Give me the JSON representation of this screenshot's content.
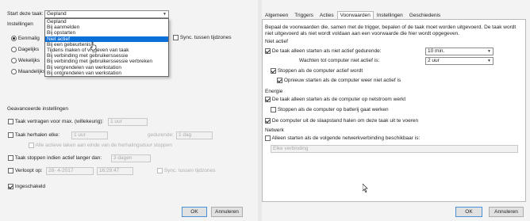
{
  "left": {
    "start_task_label": "Start deze taak:",
    "start_task_value": "Gepland",
    "dropdown_options": [
      "Gepland",
      "Bij aanmelden",
      "Bij opstarten",
      "Niet actief",
      "Bij een gebeurtenis",
      "Tijdens maken of vrijgeven van taak",
      "Bij verbinding met gebruikerssessie",
      "Bij verbinding met gebruikerssessie verbreken",
      "Bij vergrendelen van werkstation",
      "Bij ontgrendelen van werkstation"
    ],
    "selected_option_index": 3,
    "settings_label": "Instellingen",
    "radio_once": "Eenmalig",
    "radio_daily": "Dagelijks",
    "radio_weekly": "Wekelijks",
    "radio_monthly": "Maandelijks",
    "sync_timezones": "Sync. tussen tijdzones",
    "advanced_label": "Geavanceerde instellingen",
    "delay_task": "Taak vertragen voor max. (willekeurig):",
    "delay_value": "1 uur",
    "repeat_task": "Taak herhalen elke:",
    "repeat_value": "1 uur",
    "duration_label": "gedurende:",
    "duration_value": "1 dag",
    "stop_running": "Alle actieve taken aan einde van de herhalingsduur stoppen",
    "stop_longer": "Taak stoppen indien actief langer dan:",
    "stop_longer_value": "3 dagen",
    "expires": "Verloopt op:",
    "expires_date": "28- 4-2017",
    "expires_time": "16:29:47",
    "sync_timezones2": "Sync. tussen tijdzones",
    "enabled": "Ingeschakeld",
    "ok": "OK",
    "cancel": "Annuleren"
  },
  "right": {
    "tabs": [
      "Algemeen",
      "Triggers",
      "Acties",
      "Voorwaarden",
      "Instellingen",
      "Geschiedenis"
    ],
    "active_tab_index": 3,
    "description_line1": "Bepaal de voorwaarden die, samen met de trigger, bepalen of de taak moet worden uitgevoerd. De taak wordt",
    "description_line2": "niet uitgevoerd als niet wordt voldaan aan een voorwaarde die hier wordt opgegeven.",
    "idle_section": "Niet actief",
    "idle_start": "De taak alleen starten als niet actief gedurende:",
    "idle_start_value": "10 min.",
    "wait_idle": "Wachten tot computer niet actief is:",
    "wait_idle_value": "2 uur",
    "stop_not_idle": "Stoppen als de computer actief wordt",
    "restart_idle": "Opnieuw starten als de computer weer niet actief is",
    "energy_section": "Energie",
    "ac_power": "De taak alleen starten als de computer op netstroom werkt",
    "battery_stop": "Stoppen als de computer op batterij gaat werken",
    "wake": "De computer uit de slaapstand halen om deze taak uit te voeren",
    "network_section": "Netwerk",
    "network_start": "Alleen starten als de volgende netwerkverbinding beschikbaar is:",
    "network_value": "Elke verbinding",
    "ok": "OK",
    "cancel": "Annuleren"
  }
}
